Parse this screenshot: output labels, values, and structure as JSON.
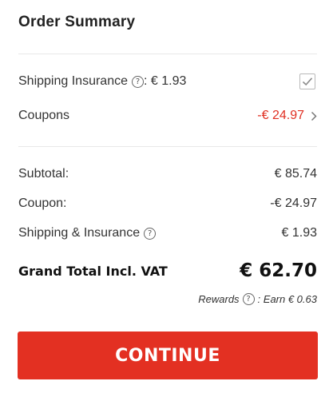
{
  "summary": {
    "title": "Order Summary"
  },
  "options": {
    "insurance_label": "Shipping Insurance",
    "insurance_price": ": € 1.93",
    "insurance_checked": true,
    "coupons_label": "Coupons",
    "coupons_value": "-€ 24.97"
  },
  "totals": {
    "subtotal_label": "Subtotal:",
    "subtotal_value": "€ 85.74",
    "coupon_label": "Coupon:",
    "coupon_value": "-€ 24.97",
    "shipping_label": "Shipping & Insurance",
    "shipping_value": "€ 1.93",
    "grand_label": "Grand Total Incl. VAT",
    "grand_value": "€ 62.70"
  },
  "rewards": {
    "label": "Rewards",
    "value": ": Earn € 0.63"
  },
  "actions": {
    "continue_label": "CONTINUE"
  },
  "icons": {
    "help": "question-circle-icon",
    "checkbox": "checkmark-icon",
    "chevron": "chevron-right-icon"
  },
  "colors": {
    "accent": "#e33022",
    "discount": "#e02f22"
  }
}
